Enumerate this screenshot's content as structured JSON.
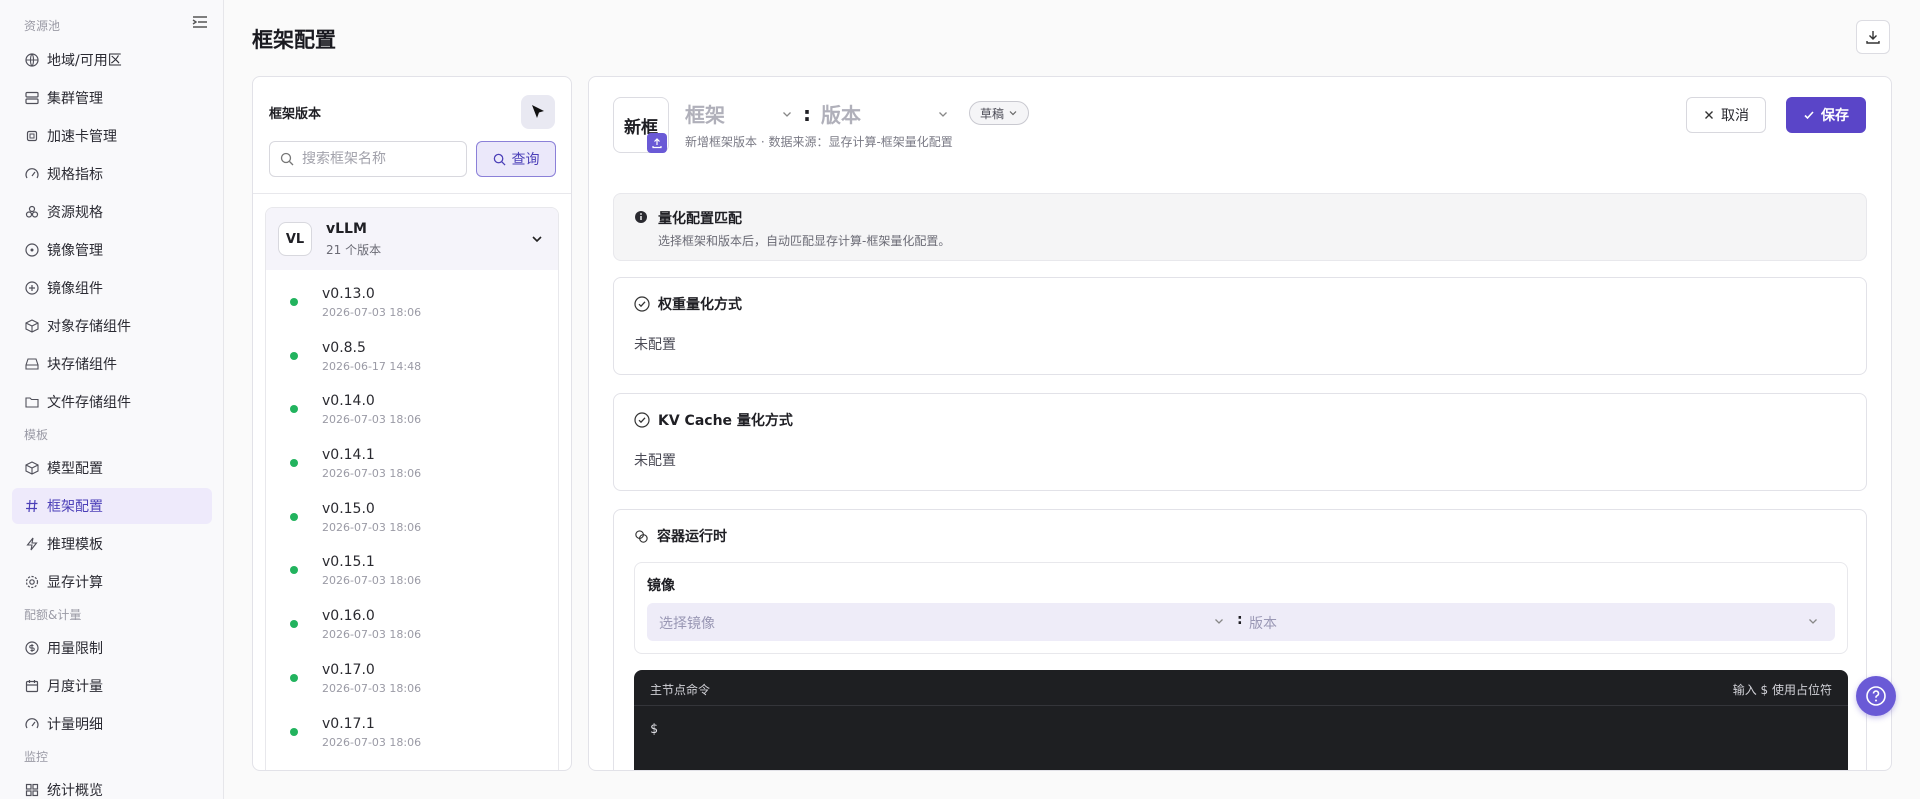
{
  "sidebar": {
    "groups": [
      "资源池",
      "模板",
      "配额&计量",
      "监控"
    ],
    "items": [
      {
        "label": "地域/可用区",
        "icon": "globe-icon"
      },
      {
        "label": "集群管理",
        "icon": "server-icon"
      },
      {
        "label": "加速卡管理",
        "icon": "chip-icon"
      },
      {
        "label": "规格指标",
        "icon": "gauge-icon"
      },
      {
        "label": "资源规格",
        "icon": "layers-icon"
      },
      {
        "label": "镜像管理",
        "icon": "disc-icon"
      },
      {
        "label": "镜像组件",
        "icon": "disc-icon"
      },
      {
        "label": "对象存储组件",
        "icon": "box-icon"
      },
      {
        "label": "块存储组件",
        "icon": "drive-icon"
      },
      {
        "label": "文件存储组件",
        "icon": "folder-icon"
      },
      {
        "label": "模型配置",
        "icon": "cube-icon"
      },
      {
        "label": "框架配置",
        "icon": "hash-icon"
      },
      {
        "label": "推理模板",
        "icon": "bolt-icon"
      },
      {
        "label": "显存计算",
        "icon": "gear-icon"
      },
      {
        "label": "用量限制",
        "icon": "coin-icon"
      },
      {
        "label": "月度计量",
        "icon": "calendar-icon"
      },
      {
        "label": "计量明细",
        "icon": "gauge-icon"
      },
      {
        "label": "统计概览",
        "icon": "grid-icon"
      }
    ]
  },
  "page": {
    "title": "框架配置"
  },
  "left_panel": {
    "title": "框架版本",
    "search_placeholder": "搜索框架名称",
    "query_label": "查询",
    "framework": {
      "avatar": "VL",
      "name": "vLLM",
      "count": "21 个版本"
    },
    "versions": [
      {
        "name": "v0.13.0",
        "time": "2026-07-03 18:06"
      },
      {
        "name": "v0.8.5",
        "time": "2026-06-17 14:48"
      },
      {
        "name": "v0.14.0",
        "time": "2026-07-03 18:06"
      },
      {
        "name": "v0.14.1",
        "time": "2026-07-03 18:06"
      },
      {
        "name": "v0.15.0",
        "time": "2026-07-03 18:06"
      },
      {
        "name": "v0.15.1",
        "time": "2026-07-03 18:06"
      },
      {
        "name": "v0.16.0",
        "time": "2026-07-03 18:06"
      },
      {
        "name": "v0.17.0",
        "time": "2026-07-03 18:06"
      },
      {
        "name": "v0.17.1",
        "time": "2026-07-03 18:06"
      }
    ]
  },
  "right_panel": {
    "badge": "新框",
    "framework_placeholder": "框架",
    "version_placeholder": "版本",
    "draft_label": "草稿",
    "subtitle": "新增框架版本 · 数据来源：显存计算-框架量化配置",
    "cancel_label": "取消",
    "save_label": "保存",
    "info": {
      "title": "量化配置匹配",
      "desc": "选择框架和版本后，自动匹配显存计算-框架量化配置。"
    },
    "weight": {
      "title": "权重量化方式",
      "value": "未配置"
    },
    "kv": {
      "title": "KV Cache 量化方式",
      "value": "未配置"
    },
    "runtime": {
      "title": "容器运行时",
      "mirror_label": "镜像",
      "mirror_placeholder": "选择镜像",
      "mirror_version_placeholder": "版本",
      "terminal_title": "主节点命令",
      "terminal_hint": "输入 $ 使用占位符",
      "prompt": "$"
    }
  },
  "colors": {
    "accent": "#5a45c8",
    "accent_light": "#ebe8fa",
    "success": "#22b35e"
  }
}
